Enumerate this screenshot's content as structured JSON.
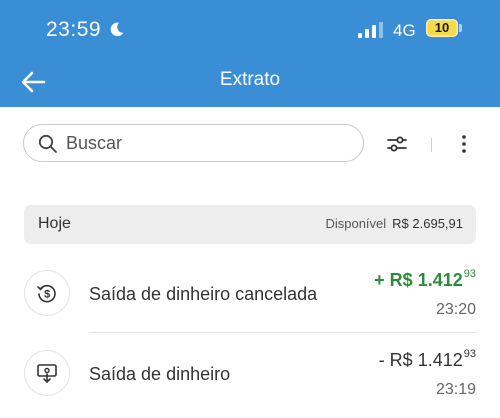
{
  "status_bar": {
    "time": "23:59",
    "network": "4G",
    "battery": "10"
  },
  "app_bar": {
    "title": "Extrato"
  },
  "search": {
    "placeholder": "Buscar"
  },
  "day_group": {
    "label": "Hoje",
    "available_label": "Disponível",
    "available_amount": "R$  2.695,91"
  },
  "transactions": [
    {
      "title": "Saída de dinheiro cancelada",
      "amount_main": "+ R$ 1.412",
      "amount_cents": "93",
      "time": "23:20",
      "amount_color": "#2e8b3d",
      "icon": "money-return-icon"
    },
    {
      "title": "Saída de dinheiro",
      "amount_main": "- R$ 1.412",
      "amount_cents": "93",
      "time": "23:19",
      "amount_color": "#333333",
      "icon": "cash-out-icon"
    }
  ],
  "colors": {
    "header": "#3a8ed6",
    "positive": "#2e8b3d",
    "battery": "#f7d94c"
  }
}
